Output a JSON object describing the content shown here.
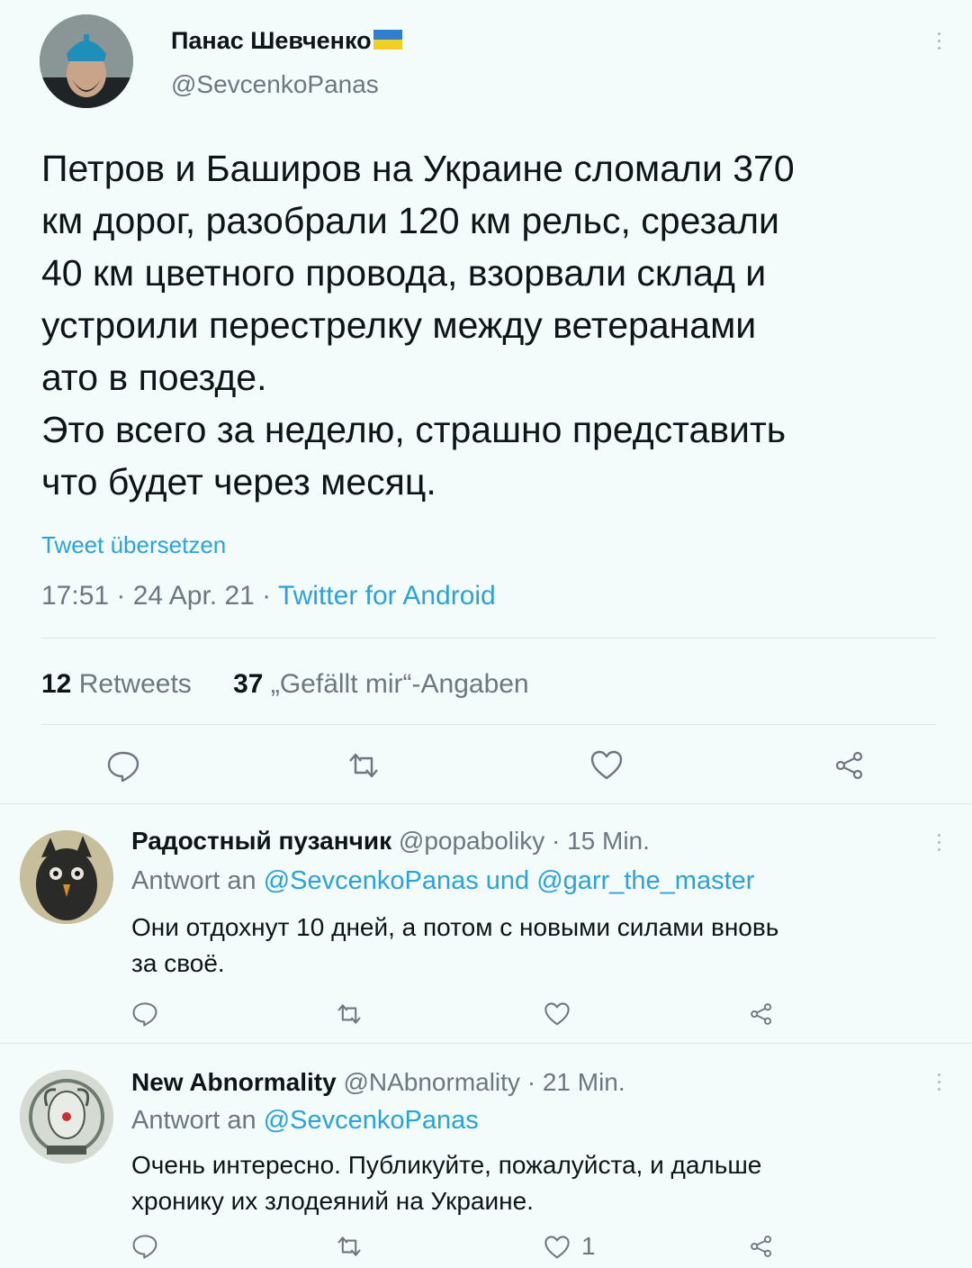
{
  "main_tweet": {
    "author_name": "Панас Шевченко",
    "author_handle": "@SevcenkoPanas",
    "text_lines": [
      "Петров и Баширов на Украине сломали 370",
      "км дорог, разобрали 120 км рельс, срезали",
      "40 км цветного провода, взорвали склад и",
      "устроили перестрелку между ветеранами",
      "ато в поезде.",
      "Это всего за неделю, страшно представить",
      "что будет через месяц."
    ],
    "translate_label": "Tweet übersetzen",
    "time": "17:51 · 24 Apr. 21 · ",
    "source": "Twitter for Android",
    "retweets_count": "12",
    "retweets_label": "Retweets",
    "likes_count": "37",
    "likes_label": "„Gefällt mir“-Angaben"
  },
  "replies": [
    {
      "author_name": "Радостный пузанчик",
      "meta": "@popaboliky · 15 Min.",
      "reply_to_prefix": "Antwort an ",
      "reply_to_handles": "@SevcenkoPanas und @garr_the_master",
      "text_lines": [
        "Они отдохнут 10 дней, а потом с новыми силами вновь",
        "за своё."
      ],
      "like_count": ""
    },
    {
      "author_name": "New Abnormality",
      "meta": "@NAbnormality · 21 Min.",
      "reply_to_prefix": "Antwort an ",
      "reply_to_handles": "@SevcenkoPanas",
      "text_lines": [
        "Очень интересно. Публикуйте, пожалуйста, и дальше",
        "хронику их злодеяний на Украине."
      ],
      "like_count": "1"
    }
  ],
  "colors": {
    "background": "#f4fbfb",
    "link": "#2aa3dc",
    "secondary_text": "#6c7780",
    "flag_blue": "#2f7fd0",
    "flag_yellow": "#f5cf1f"
  }
}
